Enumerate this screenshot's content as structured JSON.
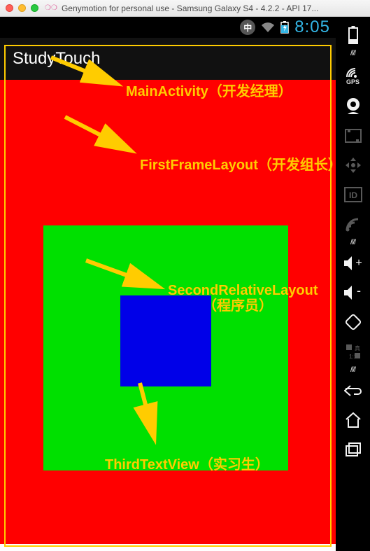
{
  "mac_titlebar": {
    "title": "Genymotion for personal use - Samsung Galaxy S4 - 4.2.2 - API 17..."
  },
  "status_bar": {
    "ime_label": "中",
    "clock": "8:05"
  },
  "action_bar": {
    "app_title": "StudyTouch"
  },
  "annotations": {
    "main_activity": "MainActivity（开发经理）",
    "first_frame": "FirstFrameLayout（开发组长）",
    "second_rel_l1": "SecondRelativeLayout",
    "second_rel_l2": "（程序员）",
    "third_text": "ThirdTextView（实习生）"
  },
  "sidebar": {
    "gps_label": "GPS"
  }
}
